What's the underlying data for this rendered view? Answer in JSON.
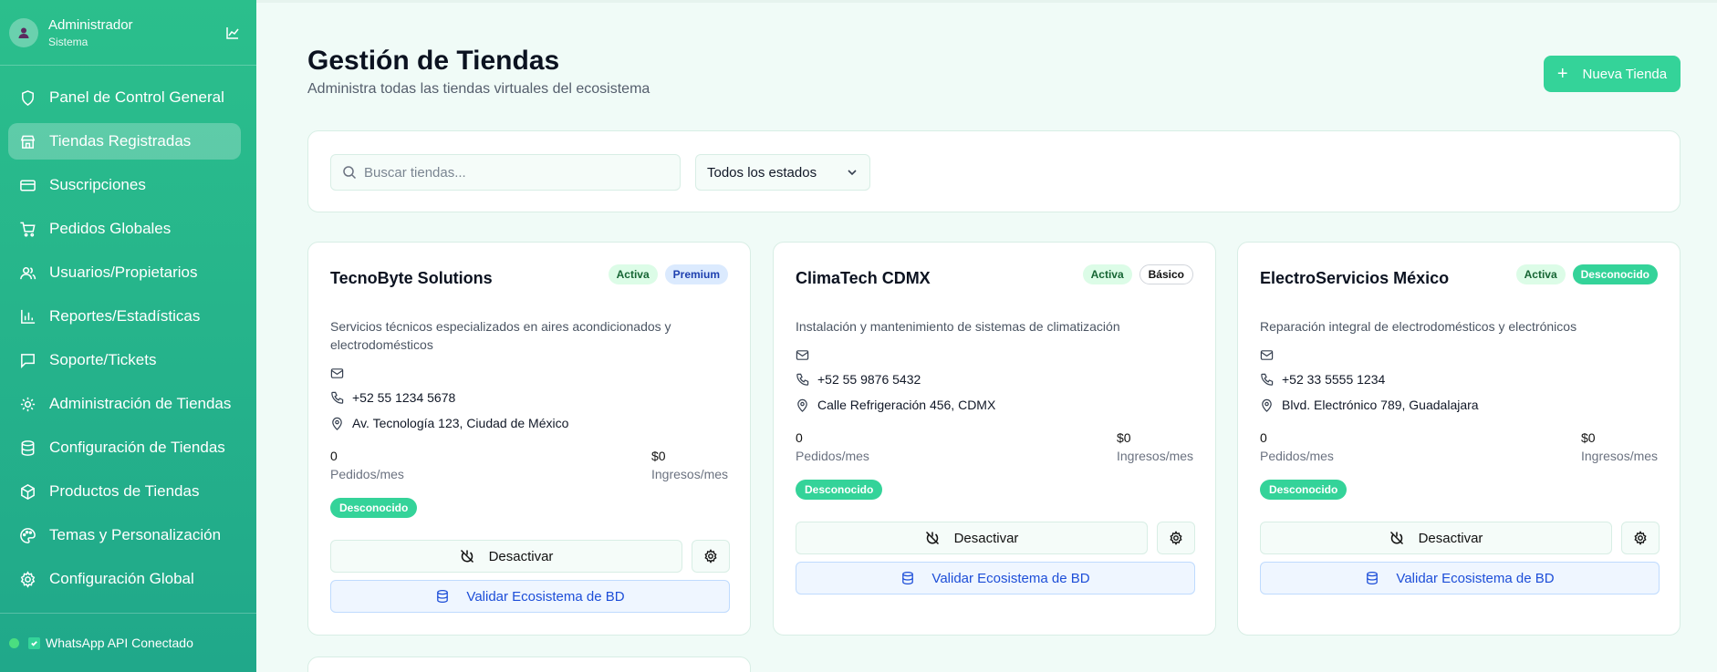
{
  "sidebar": {
    "user_name": "Administrador",
    "user_role": "Sistema",
    "items": [
      {
        "label": "Panel de Control General",
        "icon": "shield-icon"
      },
      {
        "label": "Tiendas Registradas",
        "icon": "store-icon",
        "active": true
      },
      {
        "label": "Suscripciones",
        "icon": "credit-card-icon"
      },
      {
        "label": "Pedidos Globales",
        "icon": "cart-icon"
      },
      {
        "label": "Usuarios/Propietarios",
        "icon": "users-icon"
      },
      {
        "label": "Reportes/Estadísticas",
        "icon": "bar-chart-icon"
      },
      {
        "label": "Soporte/Tickets",
        "icon": "message-icon"
      },
      {
        "label": "Administración de Tiendas",
        "icon": "cog-icon"
      },
      {
        "label": "Configuración de Tiendas",
        "icon": "database-icon"
      },
      {
        "label": "Productos de Tiendas",
        "icon": "package-icon"
      },
      {
        "label": "Temas y Personalización",
        "icon": "palette-icon"
      },
      {
        "label": "Configuración Global",
        "icon": "settings-icon"
      }
    ],
    "footer": "WhatsApp API Conectado"
  },
  "header": {
    "title": "Gestión de Tiendas",
    "subtitle": "Administra todas las tiendas virtuales del ecosistema",
    "new_button": "Nueva Tienda"
  },
  "filters": {
    "search_placeholder": "Buscar tiendas...",
    "status_select": "Todos los estados"
  },
  "stores": [
    {
      "name": "TecnoByte Solutions",
      "status": "Activa",
      "plan": "Premium",
      "description": "Servicios técnicos especializados en aires acondicionados y electrodomésticos",
      "phone": "+52 55 1234 5678",
      "address": "Av. Tecnología 123, Ciudad de México",
      "orders": "0",
      "orders_label": "Pedidos/mes",
      "revenue": "$0",
      "revenue_label": "Ingresos/mes",
      "connection": "Desconocido",
      "deactivate": "Desactivar",
      "validate": "Validar Ecosistema de BD"
    },
    {
      "name": "ClimaTech CDMX",
      "status": "Activa",
      "plan": "Básico",
      "description": "Instalación y mantenimiento de sistemas de climatización",
      "phone": "+52 55 9876 5432",
      "address": "Calle Refrigeración 456, CDMX",
      "orders": "0",
      "orders_label": "Pedidos/mes",
      "revenue": "$0",
      "revenue_label": "Ingresos/mes",
      "connection": "Desconocido",
      "deactivate": "Desactivar",
      "validate": "Validar Ecosistema de BD"
    },
    {
      "name": "ElectroServicios México",
      "status": "Activa",
      "plan": "Desconocido",
      "description": "Reparación integral de electrodomésticos y electrónicos",
      "phone": "+52 33 5555 1234",
      "address": "Blvd. Electrónico 789, Guadalajara",
      "orders": "0",
      "orders_label": "Pedidos/mes",
      "revenue": "$0",
      "revenue_label": "Ingresos/mes",
      "connection": "Desconocido",
      "deactivate": "Desactivar",
      "validate": "Validar Ecosistema de BD"
    }
  ]
}
